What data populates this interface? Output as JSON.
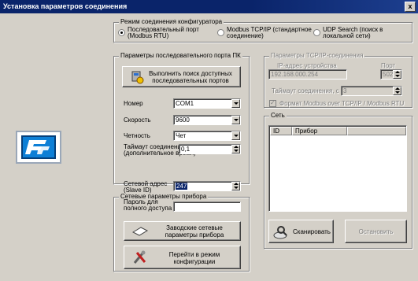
{
  "window": {
    "title": "Установка параметров соединения",
    "close_label": "x"
  },
  "mode": {
    "legend": "Режим соединения конфигуратора",
    "options": [
      {
        "label_1": "Последовательный порт",
        "label_2": "(Modbus RTU)",
        "selected": true
      },
      {
        "label_1": "Modbus TCP/IP (стандартное",
        "label_2": "соединение)",
        "selected": false
      },
      {
        "label_1": "UDP Search (поиск в",
        "label_2": "локальной сети)",
        "selected": false
      }
    ]
  },
  "serial": {
    "legend": "Параметры последовательного порта ПК",
    "search_button_1": "Выполнить поиск доступных",
    "search_button_2": "последовательных портов",
    "number_label": "Номер",
    "number_value": "COM1",
    "speed_label": "Скорость",
    "speed_value": "9600",
    "parity_label": "Четность",
    "parity_value": "Чет",
    "timeout_label_1": "Таймаут соединения, с :",
    "timeout_label_2": "(дополнительное время)",
    "timeout_value": "0,1"
  },
  "tcp": {
    "legend": "Параметры TCP/IP-соединения",
    "ip_label": "IP-адрес устройства",
    "ip_value": "192.168.000.254",
    "port_label": "Порт",
    "port_value": "502",
    "timeout_label": "Таймаут соединения, с :",
    "timeout_value": "3",
    "format_label": "Формат Modbus over TCP/IP / Modbus RTU"
  },
  "network": {
    "legend": "Сеть",
    "columns": [
      "ID",
      "Прибор"
    ],
    "scan_button": "Сканировать",
    "stop_button": "Остановить"
  },
  "device": {
    "legend": "Сетевые параметры прибора",
    "address_label_1": "Сетевой адрес",
    "address_label_2": "(Slave ID)",
    "address_value": "247",
    "password_label_1": "Пароль для",
    "password_label_2": "полного доступа",
    "password_value": "",
    "factory_button_1": "Заводские сетевые",
    "factory_button_2": "параметры прибора",
    "config_button_1": "Перейти в режим",
    "config_button_2": "конфигурации"
  },
  "colors": {
    "titlebar": "#0a246a",
    "face": "#d4d0c8",
    "logo": "#0d7fd6"
  }
}
